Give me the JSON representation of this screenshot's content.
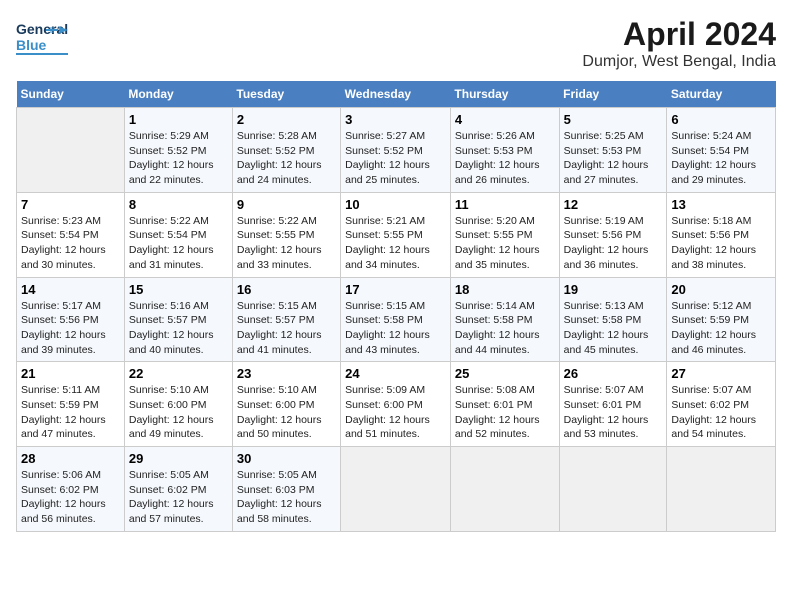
{
  "header": {
    "logo_general": "General",
    "logo_blue": "Blue",
    "title": "April 2024",
    "subtitle": "Dumjor, West Bengal, India"
  },
  "days_of_week": [
    "Sunday",
    "Monday",
    "Tuesday",
    "Wednesday",
    "Thursday",
    "Friday",
    "Saturday"
  ],
  "weeks": [
    [
      {
        "day": "",
        "info": ""
      },
      {
        "day": "1",
        "info": "Sunrise: 5:29 AM\nSunset: 5:52 PM\nDaylight: 12 hours\nand 22 minutes."
      },
      {
        "day": "2",
        "info": "Sunrise: 5:28 AM\nSunset: 5:52 PM\nDaylight: 12 hours\nand 24 minutes."
      },
      {
        "day": "3",
        "info": "Sunrise: 5:27 AM\nSunset: 5:52 PM\nDaylight: 12 hours\nand 25 minutes."
      },
      {
        "day": "4",
        "info": "Sunrise: 5:26 AM\nSunset: 5:53 PM\nDaylight: 12 hours\nand 26 minutes."
      },
      {
        "day": "5",
        "info": "Sunrise: 5:25 AM\nSunset: 5:53 PM\nDaylight: 12 hours\nand 27 minutes."
      },
      {
        "day": "6",
        "info": "Sunrise: 5:24 AM\nSunset: 5:54 PM\nDaylight: 12 hours\nand 29 minutes."
      }
    ],
    [
      {
        "day": "7",
        "info": "Sunrise: 5:23 AM\nSunset: 5:54 PM\nDaylight: 12 hours\nand 30 minutes."
      },
      {
        "day": "8",
        "info": "Sunrise: 5:22 AM\nSunset: 5:54 PM\nDaylight: 12 hours\nand 31 minutes."
      },
      {
        "day": "9",
        "info": "Sunrise: 5:22 AM\nSunset: 5:55 PM\nDaylight: 12 hours\nand 33 minutes."
      },
      {
        "day": "10",
        "info": "Sunrise: 5:21 AM\nSunset: 5:55 PM\nDaylight: 12 hours\nand 34 minutes."
      },
      {
        "day": "11",
        "info": "Sunrise: 5:20 AM\nSunset: 5:55 PM\nDaylight: 12 hours\nand 35 minutes."
      },
      {
        "day": "12",
        "info": "Sunrise: 5:19 AM\nSunset: 5:56 PM\nDaylight: 12 hours\nand 36 minutes."
      },
      {
        "day": "13",
        "info": "Sunrise: 5:18 AM\nSunset: 5:56 PM\nDaylight: 12 hours\nand 38 minutes."
      }
    ],
    [
      {
        "day": "14",
        "info": "Sunrise: 5:17 AM\nSunset: 5:56 PM\nDaylight: 12 hours\nand 39 minutes."
      },
      {
        "day": "15",
        "info": "Sunrise: 5:16 AM\nSunset: 5:57 PM\nDaylight: 12 hours\nand 40 minutes."
      },
      {
        "day": "16",
        "info": "Sunrise: 5:15 AM\nSunset: 5:57 PM\nDaylight: 12 hours\nand 41 minutes."
      },
      {
        "day": "17",
        "info": "Sunrise: 5:15 AM\nSunset: 5:58 PM\nDaylight: 12 hours\nand 43 minutes."
      },
      {
        "day": "18",
        "info": "Sunrise: 5:14 AM\nSunset: 5:58 PM\nDaylight: 12 hours\nand 44 minutes."
      },
      {
        "day": "19",
        "info": "Sunrise: 5:13 AM\nSunset: 5:58 PM\nDaylight: 12 hours\nand 45 minutes."
      },
      {
        "day": "20",
        "info": "Sunrise: 5:12 AM\nSunset: 5:59 PM\nDaylight: 12 hours\nand 46 minutes."
      }
    ],
    [
      {
        "day": "21",
        "info": "Sunrise: 5:11 AM\nSunset: 5:59 PM\nDaylight: 12 hours\nand 47 minutes."
      },
      {
        "day": "22",
        "info": "Sunrise: 5:10 AM\nSunset: 6:00 PM\nDaylight: 12 hours\nand 49 minutes."
      },
      {
        "day": "23",
        "info": "Sunrise: 5:10 AM\nSunset: 6:00 PM\nDaylight: 12 hours\nand 50 minutes."
      },
      {
        "day": "24",
        "info": "Sunrise: 5:09 AM\nSunset: 6:00 PM\nDaylight: 12 hours\nand 51 minutes."
      },
      {
        "day": "25",
        "info": "Sunrise: 5:08 AM\nSunset: 6:01 PM\nDaylight: 12 hours\nand 52 minutes."
      },
      {
        "day": "26",
        "info": "Sunrise: 5:07 AM\nSunset: 6:01 PM\nDaylight: 12 hours\nand 53 minutes."
      },
      {
        "day": "27",
        "info": "Sunrise: 5:07 AM\nSunset: 6:02 PM\nDaylight: 12 hours\nand 54 minutes."
      }
    ],
    [
      {
        "day": "28",
        "info": "Sunrise: 5:06 AM\nSunset: 6:02 PM\nDaylight: 12 hours\nand 56 minutes."
      },
      {
        "day": "29",
        "info": "Sunrise: 5:05 AM\nSunset: 6:02 PM\nDaylight: 12 hours\nand 57 minutes."
      },
      {
        "day": "30",
        "info": "Sunrise: 5:05 AM\nSunset: 6:03 PM\nDaylight: 12 hours\nand 58 minutes."
      },
      {
        "day": "",
        "info": ""
      },
      {
        "day": "",
        "info": ""
      },
      {
        "day": "",
        "info": ""
      },
      {
        "day": "",
        "info": ""
      }
    ]
  ]
}
